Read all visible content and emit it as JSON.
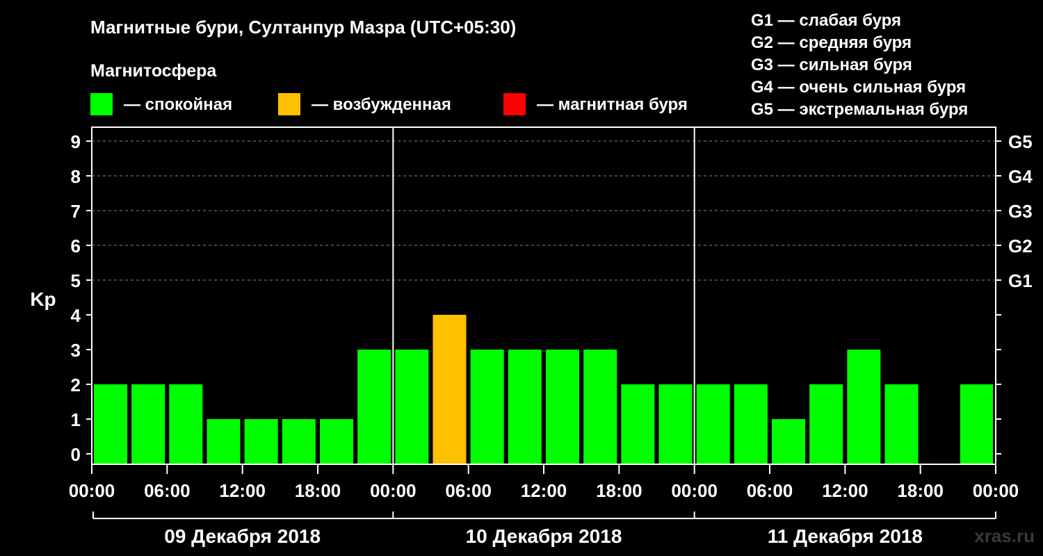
{
  "title": "Магнитные бури, Султанпур Мазра (UTC+05:30)",
  "legend": {
    "heading": "Магнитосфера",
    "items": [
      {
        "label": "— спокойная",
        "color": "#00ff00"
      },
      {
        "label": "— возбужденная",
        "color": "#ffc000"
      },
      {
        "label": "— магнитная буря",
        "color": "#ff0000"
      }
    ]
  },
  "g_scale": [
    "G1 — слабая буря",
    "G2 — средняя буря",
    "G3 — сильная буря",
    "G4 — очень сильная буря",
    "G5 — экстремальная буря"
  ],
  "watermark": "xras.ru",
  "chart_data": {
    "type": "bar",
    "ylabel": "Kp",
    "ylim": [
      0,
      9
    ],
    "y_ticks": [
      0,
      1,
      2,
      3,
      4,
      5,
      6,
      7,
      8,
      9
    ],
    "right_ticks": [
      {
        "kp": 5,
        "label": "G1"
      },
      {
        "kp": 6,
        "label": "G2"
      },
      {
        "kp": 7,
        "label": "G3"
      },
      {
        "kp": 8,
        "label": "G4"
      },
      {
        "kp": 9,
        "label": "G5"
      }
    ],
    "grid": "dashed at Kp 5–9",
    "x_tick_labels": [
      "00:00",
      "06:00",
      "12:00",
      "18:00",
      "00:00",
      "06:00",
      "12:00",
      "18:00",
      "00:00",
      "06:00",
      "12:00",
      "18:00",
      "00:00"
    ],
    "days": [
      "09 Декабря 2018",
      "10 Декабря 2018",
      "11 Декабря 2018"
    ],
    "bar_hours": [
      0,
      3,
      6,
      9,
      12,
      15,
      18,
      21,
      24,
      27,
      30,
      33,
      36,
      39,
      42,
      45,
      48,
      51,
      54,
      57,
      60,
      63,
      66,
      69
    ],
    "values": [
      2,
      2,
      2,
      1,
      1,
      1,
      1,
      3,
      3,
      4,
      3,
      3,
      3,
      3,
      2,
      2,
      2,
      2,
      1,
      2,
      3,
      2,
      null,
      2
    ],
    "status": [
      "calm",
      "calm",
      "calm",
      "calm",
      "calm",
      "calm",
      "calm",
      "calm",
      "calm",
      "excited",
      "calm",
      "calm",
      "calm",
      "calm",
      "calm",
      "calm",
      "calm",
      "calm",
      "calm",
      "calm",
      "calm",
      "calm",
      null,
      "calm"
    ],
    "status_colors": {
      "calm": "#00ff00",
      "excited": "#ffc000",
      "storm": "#ff0000"
    }
  }
}
